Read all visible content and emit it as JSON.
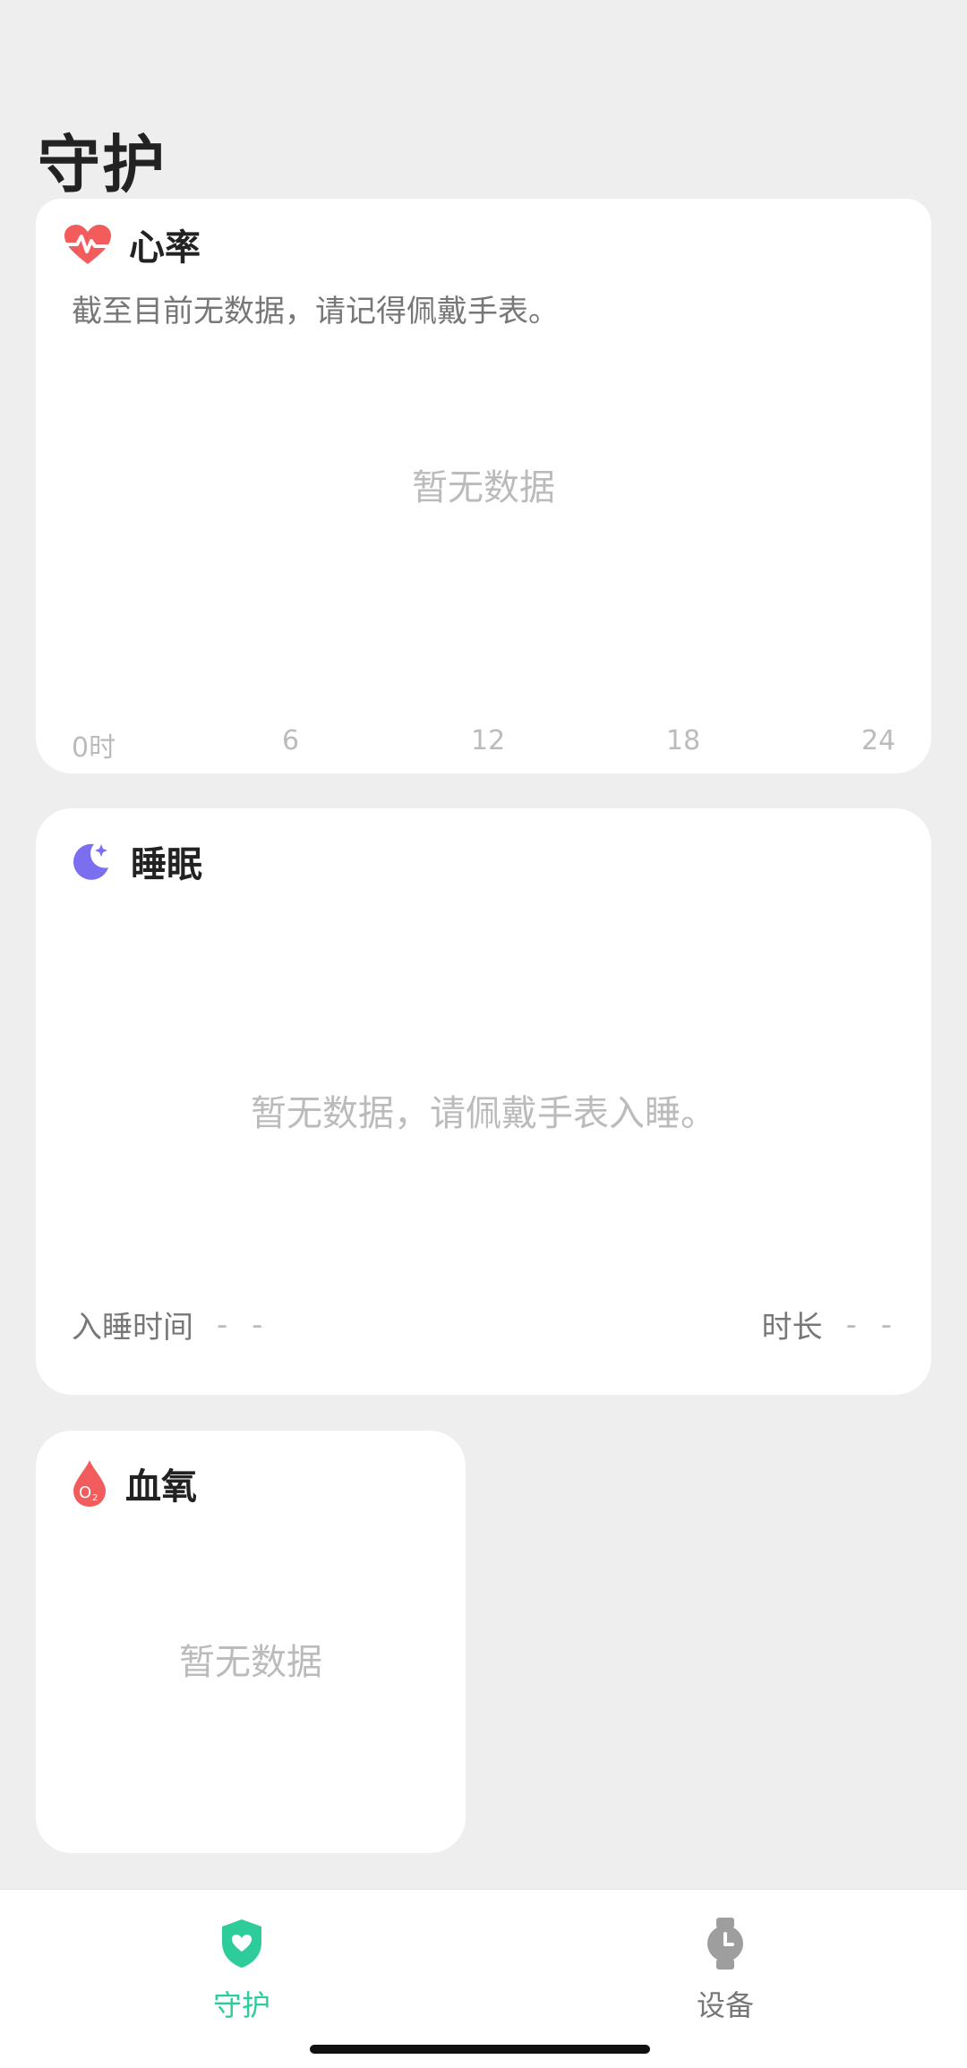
{
  "page": {
    "title": "守护"
  },
  "heart_rate": {
    "title": "心率",
    "note": "截至目前无数据，请记得佩戴手表。",
    "empty": "暂无数据",
    "axis_ticks": [
      "0时",
      "6",
      "12",
      "18",
      "24"
    ],
    "icon": "heart-pulse-icon",
    "color": "#F25C5C"
  },
  "sleep": {
    "title": "睡眠",
    "empty": "暂无数据，请佩戴手表入睡。",
    "bedtime_label": "入睡时间",
    "bedtime_value": "- -",
    "duration_label": "时长",
    "duration_value": "- -",
    "icon": "moon-icon",
    "color": "#7B6FF0"
  },
  "blood_oxygen": {
    "title": "血氧",
    "empty": "暂无数据",
    "icon": "o2-drop-icon",
    "color": "#F25C5C"
  },
  "tabbar": {
    "items": [
      {
        "label": "守护",
        "icon": "shield-heart-icon",
        "active": true
      },
      {
        "label": "设备",
        "icon": "watch-icon",
        "active": false
      }
    ],
    "active_color": "#2ECC9A"
  }
}
